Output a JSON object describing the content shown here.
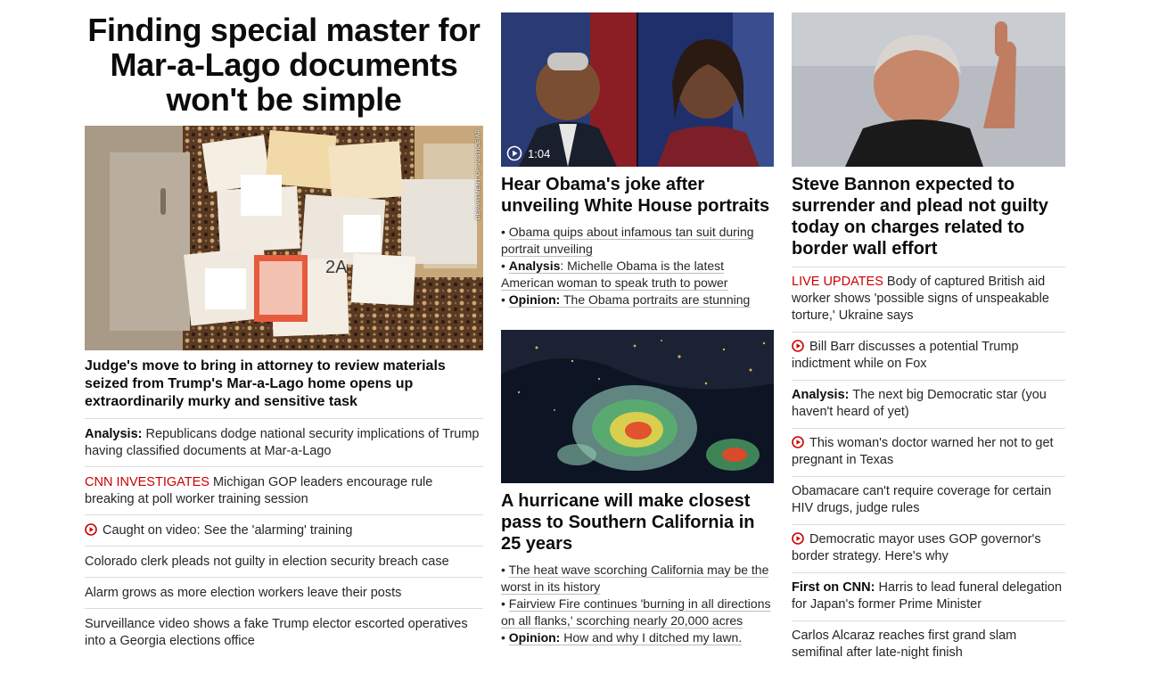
{
  "col1": {
    "headline": "Finding special master for Mar-a-Lago documents won't be simple",
    "photo_credit": "DEPARTMENT OF JUSTICE/AP",
    "story_headline": "Judge's move to bring in attorney to review materials seized from Trump's Mar-a-Lago home opens up extraordinarily murky and sensitive task",
    "links": [
      {
        "prefix": "Analysis:",
        "text": " Republicans dodge national security implications of Trump having classified documents at Mar-a-Lago"
      },
      {
        "prefix_red": "CNN INVESTIGATES",
        "text": " Michigan GOP leaders encourage rule breaking at poll worker training session"
      },
      {
        "video": true,
        "text": "Caught on video: See the 'alarming' training"
      },
      {
        "text": "Colorado clerk pleads not guilty in election security breach case"
      },
      {
        "text": "Alarm grows as more election workers leave their posts"
      },
      {
        "text": "Surveillance video shows a fake Trump elector escorted operatives into a Georgia elections office"
      }
    ]
  },
  "col2": {
    "video_duration": "1:04",
    "story1_headline": "Hear Obama's joke after unveiling White House portraits",
    "story1_bullets": [
      {
        "text": "Obama quips about infamous tan suit during portrait unveiling"
      },
      {
        "bold": "Analysis",
        "text": ": Michelle Obama is the latest American woman to speak truth to power"
      },
      {
        "bold": "Opinion:",
        "text": " The Obama portraits are stunning"
      }
    ],
    "story2_headline": "A hurricane will make closest pass to Southern California in 25 years",
    "story2_bullets": [
      {
        "text": "The heat wave scorching California may be the worst in its history"
      },
      {
        "text": "Fairview Fire continues 'burning in all directions on all flanks,' scorching nearly 20,000 acres"
      },
      {
        "bold": "Opinion:",
        "text": " How and why I ditched my lawn."
      }
    ]
  },
  "col3": {
    "story_headline": "Steve Bannon expected to surrender and plead not guilty today on charges related to border wall effort",
    "links": [
      {
        "prefix_red": "LIVE UPDATES",
        "text": " Body of captured British aid worker shows 'possible signs of unspeakable torture,' Ukraine says"
      },
      {
        "video": true,
        "text": "Bill Barr discusses a potential Trump indictment while on Fox"
      },
      {
        "prefix": "Analysis:",
        "text": " The next big Democratic star (you haven't heard of yet)"
      },
      {
        "video": true,
        "text": "This woman's doctor warned her not to get pregnant in Texas"
      },
      {
        "text": "Obamacare can't require coverage for certain HIV drugs, judge rules"
      },
      {
        "video": true,
        "text": "Democratic mayor uses GOP governor's border strategy. Here's why"
      },
      {
        "prefix": "First on CNN:",
        "text": " Harris to lead funeral delegation for Japan's former Prime Minister"
      },
      {
        "text": "Carlos Alcaraz reaches first grand slam semifinal after late-night finish"
      }
    ]
  },
  "colors": {
    "accent_red": "#cc0000",
    "divider": "#dcdcdc"
  }
}
